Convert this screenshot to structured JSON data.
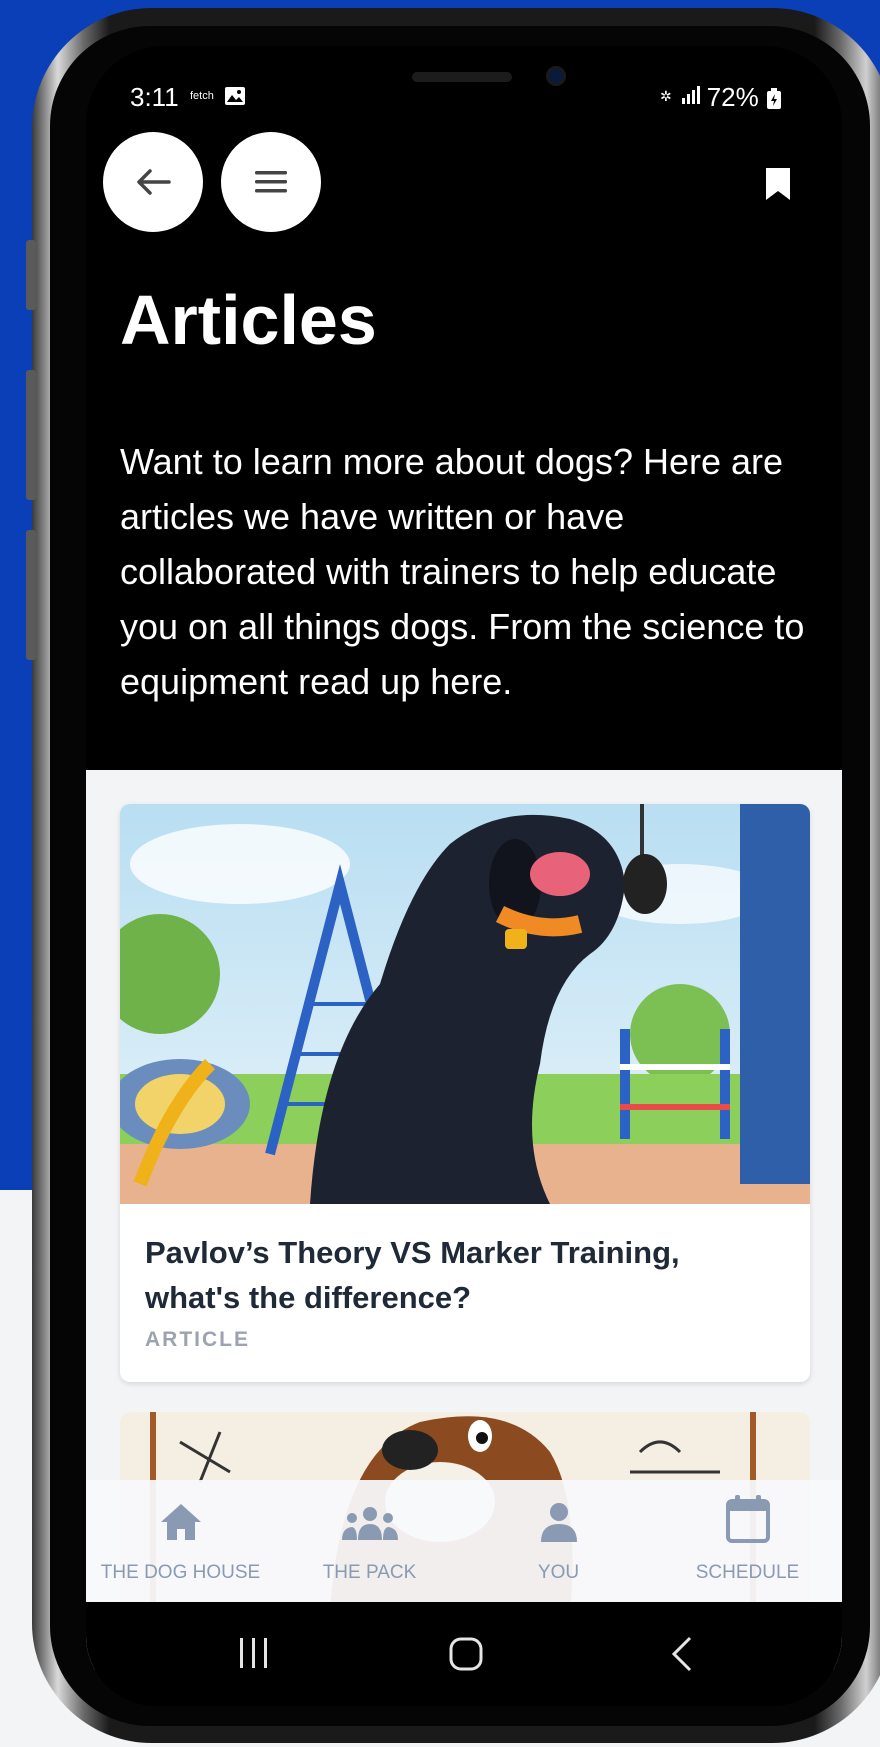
{
  "status_bar": {
    "time": "3:11",
    "notification_icons": "fetch",
    "battery": "72%"
  },
  "header": {
    "back_icon": "arrow-left-icon",
    "menu_icon": "hamburger-icon",
    "bookmark_icon": "bookmark-icon"
  },
  "page": {
    "title": "Articles",
    "description": "Want to learn more about dogs? Here are articles we have written or have collaborated with trainers to help educate you on all things dogs. From the science to equipment read up here."
  },
  "articles": [
    {
      "title": "Pavlov’s Theory VS Marker Training, what's the difference?",
      "tag": "ARTICLE"
    },
    {
      "title": "",
      "tag": ""
    }
  ],
  "bottom_nav": [
    {
      "label": "THE DOG HOUSE",
      "icon": "house-icon"
    },
    {
      "label": "THE PACK",
      "icon": "group-icon"
    },
    {
      "label": "YOU",
      "icon": "person-icon"
    },
    {
      "label": "SCHEDULE",
      "icon": "calendar-icon"
    }
  ],
  "colors": {
    "background_blue": "#0b3fb8",
    "nav_inactive": "#8a9ab3",
    "card_title": "#1f2937",
    "tag": "#9ca3af"
  }
}
